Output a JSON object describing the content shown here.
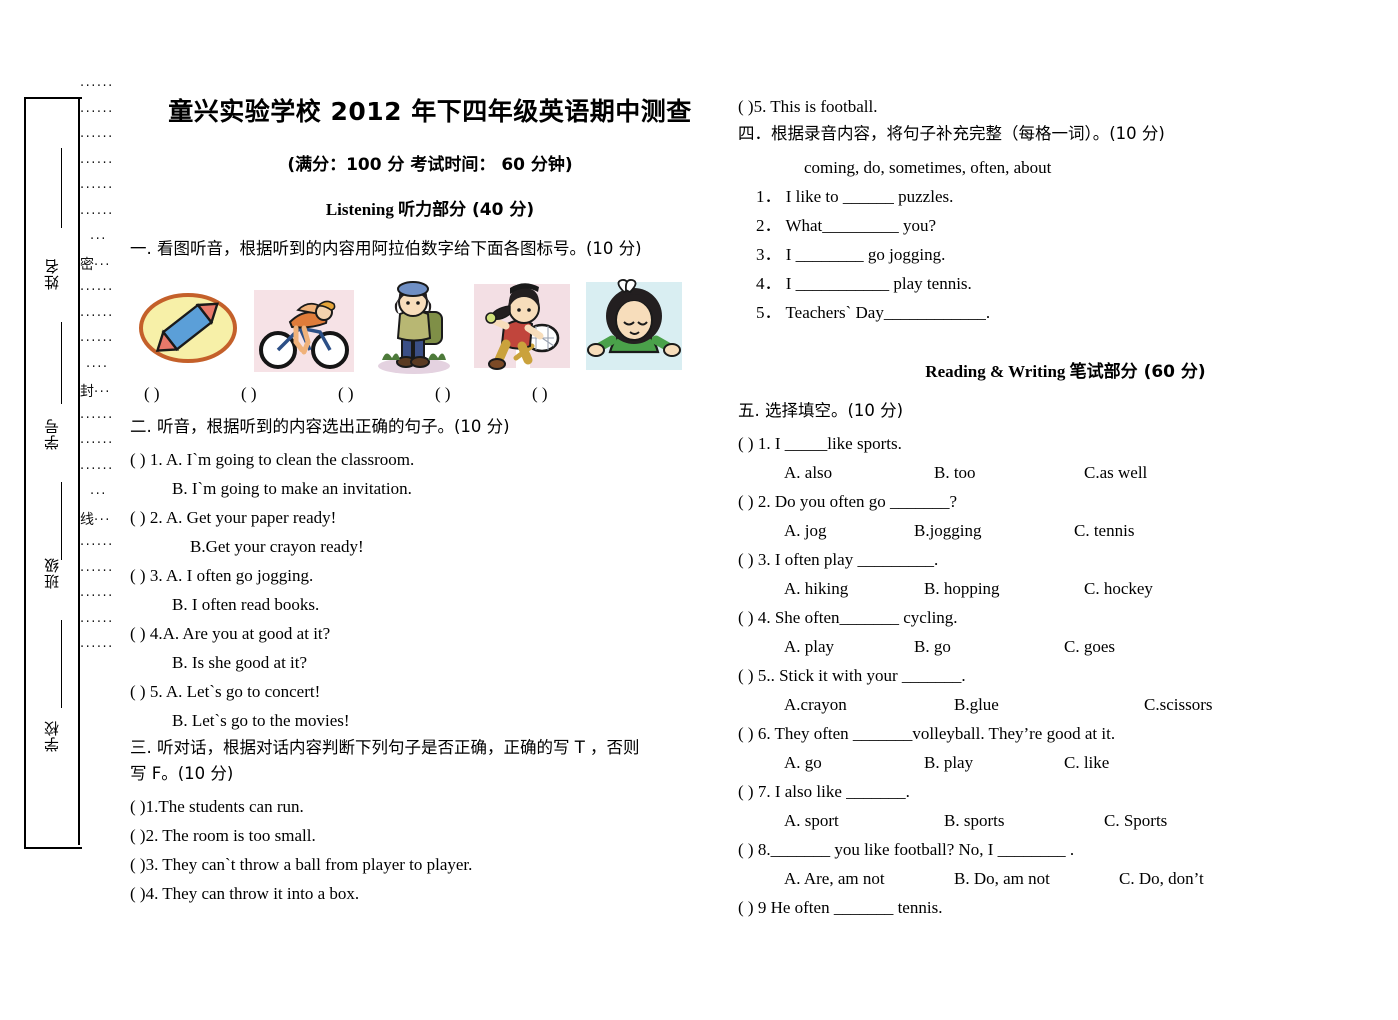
{
  "seal": {
    "fields": [
      {
        "label": "姓名"
      },
      {
        "label": "学号"
      },
      {
        "label": "班级"
      },
      {
        "label": "学校"
      }
    ],
    "line_chars": [
      "密",
      "封",
      "线"
    ],
    "dot_glyph": "······"
  },
  "header": {
    "title": "童兴实验学校 2012 年下四年级英语期中测查",
    "subtitle": "(满分：100 分    考试时间： 60 分钟)",
    "listening_banner_latin": "Listening ",
    "listening_banner_cn": "听力部分 (40 分)",
    "reading_banner_latin": "Reading & Writing ",
    "reading_banner_cn": "笔试部分 (60 分)"
  },
  "section_one": {
    "heading": "一. 看图听音，根据听到的内容用阿拉伯数字给下面各图标号。(10 分)",
    "pictures": [
      {
        "name": "crayon-in-oval",
        "alt": "blue crayon inside a yellow oval"
      },
      {
        "name": "girl-cycling",
        "alt": "girl riding a bicycle"
      },
      {
        "name": "girl-hiking",
        "alt": "girl hiking with a backpack"
      },
      {
        "name": "girl-playing-tennis",
        "alt": "girl playing tennis with racket"
      },
      {
        "name": "girl-shrugging",
        "alt": "girl in green shirt shrugging"
      }
    ],
    "bracket_count": 5,
    "bracket": "(        )"
  },
  "section_two": {
    "heading": "二. 听音，根据听到的内容选出正确的句子。(10 分)",
    "items": [
      {
        "bracket": "(    )",
        "num": "1.",
        "a": "A. I`m going to clean the classroom.",
        "b": "B. I`m going to make an invitation."
      },
      {
        "bracket": "(    )",
        "num": "2.",
        "a": "A. Get your paper ready!",
        "b": "B.Get your crayon ready!"
      },
      {
        "bracket": "(    )",
        "num": "3.",
        "a": "A. I often go jogging.",
        "b": "B. I often read books."
      },
      {
        "bracket": "(    )",
        "num": "4.",
        "a": "A. Are you at good at it?",
        "b": "B. Is she good at it?"
      },
      {
        "bracket": "(    )",
        "num": "5.",
        "a": "A. Let`s go to concert!",
        "b": "B. Let`s go to the movies!"
      }
    ]
  },
  "section_three": {
    "heading_line1": "三. 听对话，根据对话内容判断下列句子是否正确，正确的写 T ，否则",
    "heading_line2": "写 F。(10 分)",
    "items": [
      {
        "bracket": "(     )",
        "text": "1.The students can run."
      },
      {
        "bracket": "(     )",
        "text": "2. The room is too small."
      },
      {
        "bracket": "(     )",
        "text": "3. They can`t throw a ball from player to player."
      },
      {
        "bracket": "(     )",
        "text": "4. They can throw it into a box."
      },
      {
        "bracket": "(     )",
        "text": "5. This is football."
      }
    ]
  },
  "section_four": {
    "heading": "四．根据录音内容，将句子补充完整（每格一词）。(10 分)",
    "word_bank": "coming,    do,     sometimes,   often,       about",
    "items": [
      {
        "num": "1．",
        "text": "I like to ______ puzzles."
      },
      {
        "num": "2．",
        "text": "What_________ you?"
      },
      {
        "num": "3．",
        "text": "I ________ go jogging."
      },
      {
        "num": "4．",
        "text": "I ___________ play tennis."
      },
      {
        "num": "5．",
        "text": "Teachers` Day____________."
      }
    ]
  },
  "section_five": {
    "heading": "五. 选择填空。(10 分)",
    "items": [
      {
        "bracket": "(    )",
        "stem": "1. I _____like sports.",
        "options": [
          "A. also",
          "B. too",
          "C.as well"
        ],
        "widths": [
          150,
          150,
          0
        ]
      },
      {
        "bracket": "(    )",
        "stem": "2. Do you often go _______?",
        "options": [
          "A. jog",
          "B.jogging",
          "C. tennis"
        ],
        "widths": [
          130,
          160,
          0
        ]
      },
      {
        "bracket": "(    )",
        "stem": "3. I often play _________.",
        "options": [
          "A. hiking",
          "B. hopping",
          "C. hockey"
        ],
        "widths": [
          140,
          160,
          0
        ]
      },
      {
        "bracket": "(    )",
        "stem": "4. She often_______ cycling.",
        "options": [
          "A. play",
          "B. go",
          "C. goes"
        ],
        "widths": [
          130,
          150,
          0
        ]
      },
      {
        "bracket": "(    )",
        "stem": "5.. Stick it with your _______.",
        "options": [
          "A.crayon",
          "B.glue",
          "C.scissors"
        ],
        "widths": [
          170,
          190,
          0
        ]
      },
      {
        "bracket": "(    )",
        "stem": "6. They often _______volleyball. They’re good at it.",
        "options": [
          "A. go",
          "B. play",
          "C. like"
        ],
        "widths": [
          140,
          140,
          0
        ]
      },
      {
        "bracket": "(    )",
        "stem": "7. I also like _______.",
        "options": [
          "A. sport",
          "B. sports",
          "C. Sports"
        ],
        "widths": [
          160,
          160,
          0
        ]
      },
      {
        "bracket": "(    )",
        "stem": "8._______ you like football? No, I ________ .",
        "options": [
          "A. Are, am not",
          "B. Do, am not",
          "C. Do, don’t"
        ],
        "widths": [
          170,
          165,
          0
        ]
      },
      {
        "bracket": "(    )",
        "stem": "9 He often _______ tennis.",
        "options": [],
        "widths": []
      }
    ]
  }
}
